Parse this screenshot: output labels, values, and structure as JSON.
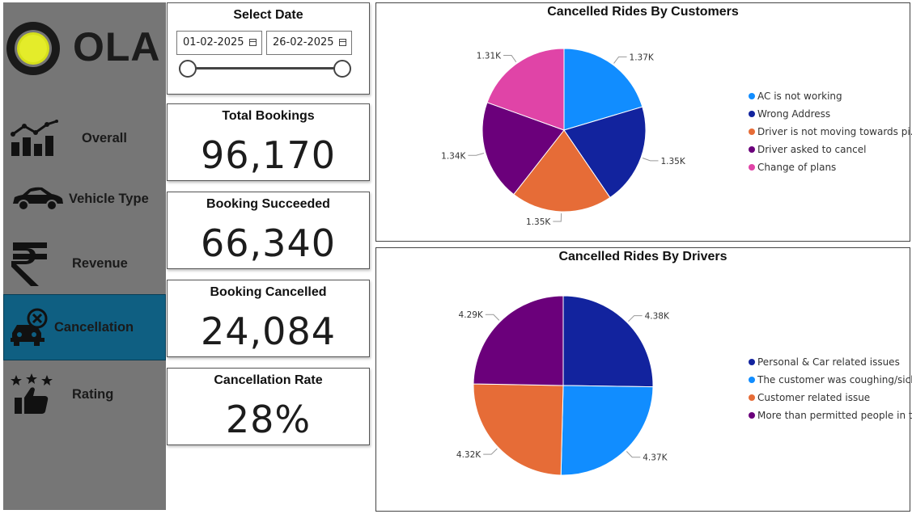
{
  "brand": {
    "name": "OLA"
  },
  "nav": {
    "items": [
      {
        "id": "overall",
        "label": "Overall",
        "icon": "bar-chart-icon"
      },
      {
        "id": "vehicle",
        "label": "Vehicle Type",
        "icon": "car-icon"
      },
      {
        "id": "revenue",
        "label": "Revenue",
        "icon": "rupee-icon"
      },
      {
        "id": "cancellation",
        "label": "Cancellation",
        "icon": "cancel-car-icon",
        "active": true
      },
      {
        "id": "rating",
        "label": "Rating",
        "icon": "thumbs-up-stars-icon"
      }
    ],
    "active_color": "#0f5f82"
  },
  "date_filter": {
    "title": "Select Date",
    "start": "01-02-2025",
    "end": "26-02-2025",
    "range_fraction": [
      0,
      1
    ]
  },
  "kpis": {
    "total": {
      "title": "Total Bookings",
      "value": "96,170"
    },
    "succeeded": {
      "title": "Booking Succeeded",
      "value": "66,340"
    },
    "cancelled": {
      "title": "Booking Cancelled",
      "value": "24,084"
    },
    "rate": {
      "title": "Cancellation Rate",
      "value": "28%"
    }
  },
  "chart_data": [
    {
      "type": "pie",
      "title": "Cancelled Rides By Customers",
      "slices": [
        {
          "name": "AC is not working",
          "value": 1370,
          "label": "1.37K",
          "color": "#118dff"
        },
        {
          "name": "Wrong Address",
          "value": 1350,
          "label": "1.35K",
          "color": "#12239e"
        },
        {
          "name": "Driver is not moving towards pi...",
          "value": 1350,
          "label": "1.35K",
          "color": "#e66c37"
        },
        {
          "name": "Driver asked to cancel",
          "value": 1340,
          "label": "1.34K",
          "color": "#6b007b"
        },
        {
          "name": "Change of plans",
          "value": 1310,
          "label": "1.31K",
          "color": "#e044a7"
        }
      ],
      "legend_position": "right"
    },
    {
      "type": "pie",
      "title": "Cancelled Rides By Drivers",
      "slices": [
        {
          "name": "Personal & Car related issues",
          "value": 4380,
          "label": "4.38K",
          "color": "#12239e"
        },
        {
          "name": "The customer was coughing/sick",
          "value": 4370,
          "label": "4.37K",
          "color": "#118dff"
        },
        {
          "name": "Customer related issue",
          "value": 4320,
          "label": "4.32K",
          "color": "#e66c37"
        },
        {
          "name": "More than permitted people in t...",
          "value": 4290,
          "label": "4.29K",
          "color": "#6b007b"
        }
      ],
      "legend_position": "right"
    }
  ]
}
